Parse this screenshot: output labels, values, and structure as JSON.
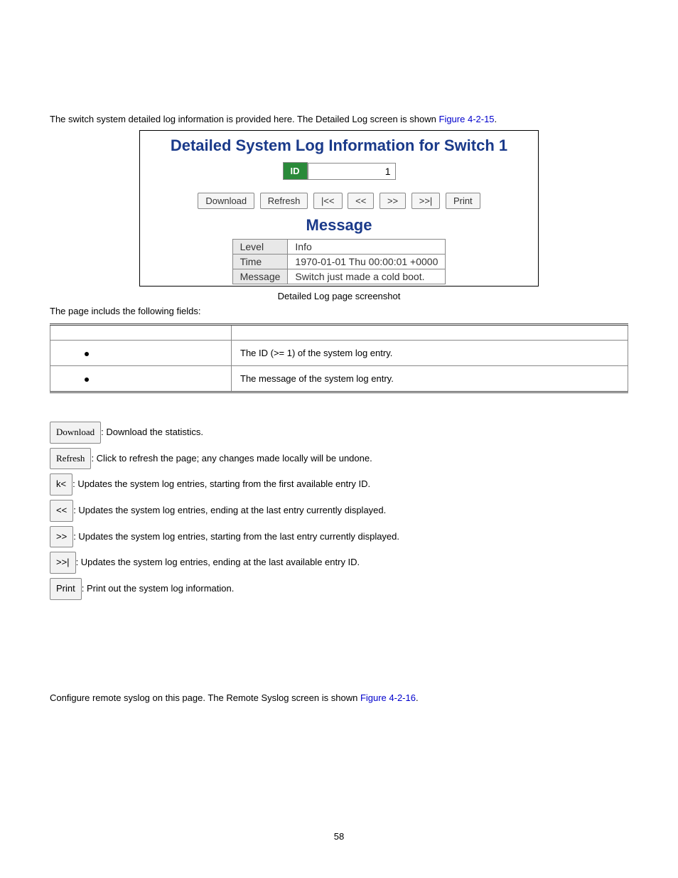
{
  "intro": {
    "text_before": "The switch system detailed log information is provided here. The Detailed Log screen is shown ",
    "link": "Figure 4-2-15",
    "text_after": "."
  },
  "screenshot": {
    "title": "Detailed System Log Information for Switch 1",
    "id_label": "ID",
    "id_value": "1",
    "buttons": {
      "download": "Download",
      "refresh": "Refresh",
      "first": "|<<",
      "prev": "<<",
      "next": ">>",
      "last": ">>|",
      "print": "Print"
    },
    "msg_title": "Message",
    "rows": {
      "level_label": "Level",
      "level_value": "Info",
      "time_label": "Time",
      "time_value": "1970-01-01 Thu 00:00:01 +0000",
      "message_label": "Message",
      "message_value": "Switch just made a cold boot."
    }
  },
  "caption": "Detailed Log page screenshot",
  "fields_intro": "The page includs the following fields:",
  "fields_table": {
    "obj_header": "",
    "desc_header": "",
    "rows": [
      {
        "desc": "The ID (>= 1) of the system log entry."
      },
      {
        "desc": "The message of the system log entry."
      }
    ]
  },
  "button_descriptions": {
    "download": {
      "label": "Download",
      "desc": ": Download the statistics."
    },
    "refresh": {
      "label": "Refresh",
      "desc": ": Click to refresh the page; any changes made locally will be undone."
    },
    "first": {
      "label": "k<",
      "desc": ": Updates the system log entries, starting from the first available entry ID."
    },
    "prev": {
      "label": "<<",
      "desc": ": Updates the system log entries, ending at the last entry currently displayed."
    },
    "next": {
      "label": ">>",
      "desc": ": Updates the system log entries, starting from the last entry currently displayed."
    },
    "last": {
      "label": ">>|",
      "desc": ": Updates the system log entries, ending at the last available entry ID."
    },
    "print": {
      "label": "Print",
      "desc": ": Print out the system log information."
    }
  },
  "remote": {
    "text_before": "Configure remote syslog on this page. The Remote Syslog screen is shown ",
    "link": "Figure 4-2-16",
    "text_after": "."
  },
  "page_number": "58"
}
